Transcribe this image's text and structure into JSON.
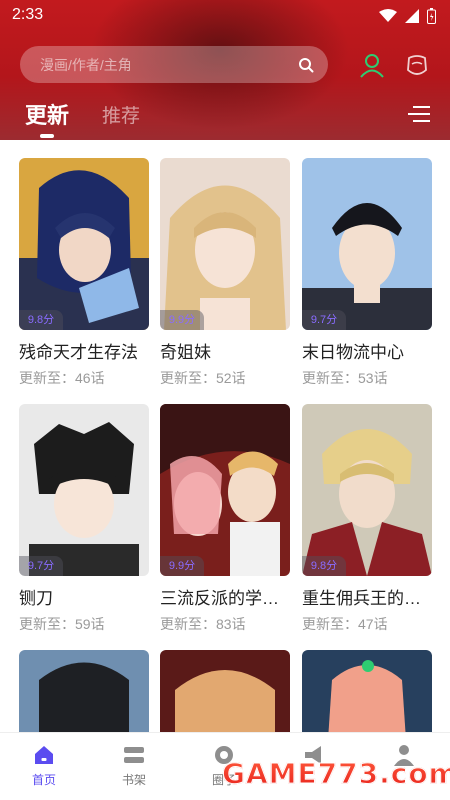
{
  "status_bar": {
    "time": "2:33"
  },
  "search": {
    "placeholder": "漫画/作者/主角"
  },
  "tabs": {
    "active": "更新",
    "inactive": "推荐"
  },
  "comics": [
    {
      "title": "残命天才生存法",
      "score": "9.8分",
      "update": "更新至：46话"
    },
    {
      "title": "奇姐妹",
      "score": "9.9分",
      "update": "更新至：52话"
    },
    {
      "title": "末日物流中心",
      "score": "9.7分",
      "update": "更新至：53话"
    },
    {
      "title": "铡刀",
      "score": "9.7分",
      "update": "更新至：59话"
    },
    {
      "title": "三流反派的学…",
      "score": "9.9分",
      "update": "更新至：83话"
    },
    {
      "title": "重生佣兵王的…",
      "score": "9.8分",
      "update": "更新至：47话"
    }
  ],
  "bottom_nav": [
    {
      "label": "首页",
      "icon": "home-icon",
      "active": true
    },
    {
      "label": "书架",
      "icon": "bookshelf-icon",
      "active": false
    },
    {
      "label": "圈子",
      "icon": "circle-icon",
      "active": false
    },
    {
      "label": "",
      "icon": "megaphone-icon",
      "active": false
    },
    {
      "label": "",
      "icon": "user-icon",
      "active": false
    }
  ],
  "watermark": "GAME773.com",
  "colors": {
    "header": "#c21a1e",
    "accent": "#5b4cf0",
    "score": "#8a6cff",
    "icon_green": "#2ecc71"
  }
}
